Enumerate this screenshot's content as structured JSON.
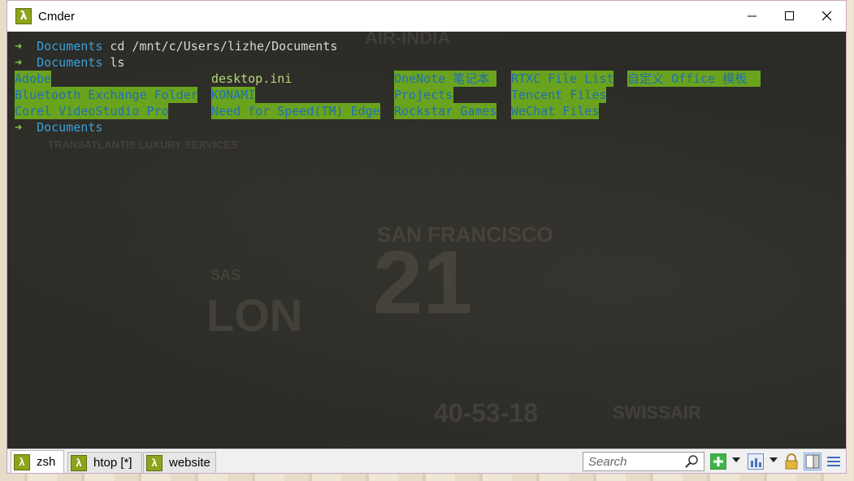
{
  "window": {
    "title": "Cmder",
    "icon": "lambda-icon",
    "icon_glyph": "λ"
  },
  "terminal": {
    "prompt_arrow": "➜",
    "lines": [
      {
        "dir": "Documents",
        "command": "cd /mnt/c/Users/lizhe/Documents"
      },
      {
        "dir": "Documents",
        "command": "ls"
      }
    ],
    "ls_rows": [
      [
        "Adobe",
        "desktop.ini",
        "OneNote 笔记本",
        "RTXC File List",
        "自定义 Office 模板"
      ],
      [
        "Bluetooth Exchange Folder",
        "KONAMI",
        "Projects",
        "Tencent Files",
        ""
      ],
      [
        "Corel VideoStudio Pro",
        "Need for Speed(TM) Edge",
        "Rockstar Games",
        "WeChat Files",
        ""
      ]
    ],
    "final_prompt_dir": "Documents"
  },
  "tabs": [
    {
      "label": "zsh",
      "active": true
    },
    {
      "label": "htop [*]",
      "active": false
    },
    {
      "label": "website",
      "active": false
    }
  ],
  "toolbar": {
    "search_placeholder": "Search",
    "icons": [
      "magnifier-icon",
      "new-console-icon",
      "chevron-down-icon",
      "layout-icon",
      "chevron-down-icon",
      "lock-icon",
      "split-view-icon",
      "menu-icon"
    ]
  },
  "colors": {
    "accent_green": "#8ea31a",
    "prompt_arrow": "#8fc93a",
    "prompt_dir": "#3aa0d8",
    "dir_highlight": "#6aa31d",
    "dir_text": "#1f6fb5"
  }
}
